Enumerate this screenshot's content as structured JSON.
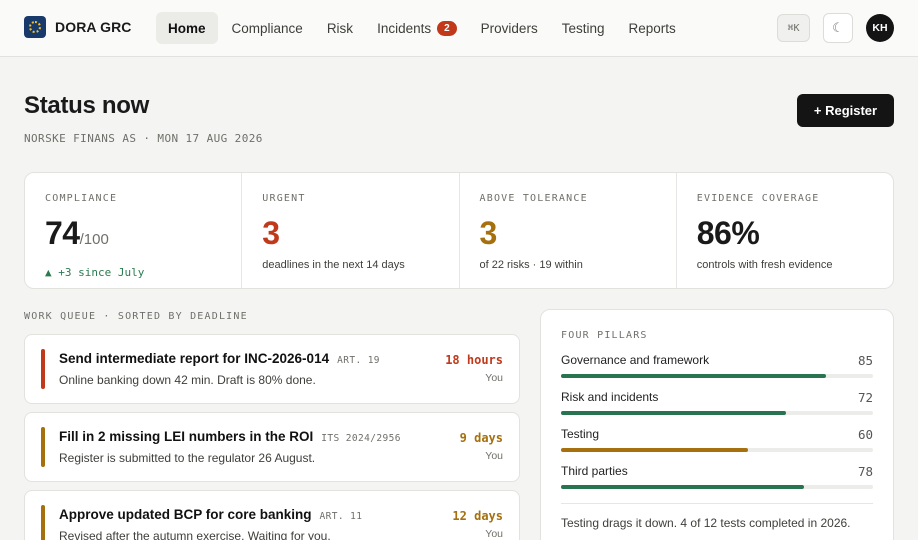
{
  "header": {
    "brand": "DORA GRC",
    "nav": [
      {
        "label": "Home",
        "active": true
      },
      {
        "label": "Compliance"
      },
      {
        "label": "Risk"
      },
      {
        "label": "Incidents",
        "badge": "2"
      },
      {
        "label": "Providers"
      },
      {
        "label": "Testing"
      },
      {
        "label": "Reports"
      }
    ],
    "shortcut": "⌘K",
    "theme_icon": "moon-icon",
    "user_initials": "KH"
  },
  "page": {
    "title": "Status now",
    "subtitle": "NORSKE FINANS AS · MON 17 AUG 2026",
    "register_button": "+ Register"
  },
  "kpis": [
    {
      "label": "COMPLIANCE",
      "value": "74",
      "suffix": "/100",
      "note": "▲ +3 since July",
      "color": "#1a1a1a",
      "note_color": "#2c7a4f"
    },
    {
      "label": "URGENT",
      "value": "3",
      "note": "deadlines in the next 14 days",
      "color": "#c0391b"
    },
    {
      "label": "ABOVE TOLERANCE",
      "value": "3",
      "note": "of 22 risks · 19 within",
      "color": "#a6700f"
    },
    {
      "label": "EVIDENCE COVERAGE",
      "value": "86%",
      "note": "controls with fresh evidence",
      "color": "#1a1a1a"
    }
  ],
  "work_queue": {
    "label": "WORK QUEUE · SORTED BY DEADLINE",
    "items": [
      {
        "title": "Send intermediate report for INC-2026-014",
        "ref": "ART. 19",
        "desc": "Online banking down 42 min. Draft is 80% done.",
        "due": "18 hours",
        "owner": "You",
        "color": "#c0391b"
      },
      {
        "title": "Fill in 2 missing LEI numbers in the ROI",
        "ref": "ITS 2024/2956",
        "desc": "Register is submitted to the regulator 26 August.",
        "due": "9 days",
        "owner": "You",
        "color": "#a6700f"
      },
      {
        "title": "Approve updated BCP for core banking",
        "ref": "ART. 11",
        "desc": "Revised after the autumn exercise. Waiting for you.",
        "due": "12 days",
        "owner": "You",
        "color": "#a6700f"
      }
    ]
  },
  "pillars": {
    "label": "FOUR PILLARS",
    "items": [
      {
        "name": "Governance and framework",
        "score": 85,
        "color": "#2a7350"
      },
      {
        "name": "Risk and incidents",
        "score": 72,
        "color": "#2a7350"
      },
      {
        "name": "Testing",
        "score": 60,
        "color": "#a6700f"
      },
      {
        "name": "Third parties",
        "score": 78,
        "color": "#2a7350"
      }
    ],
    "note": "Testing drags it down. 4 of 12 tests completed in 2026."
  }
}
